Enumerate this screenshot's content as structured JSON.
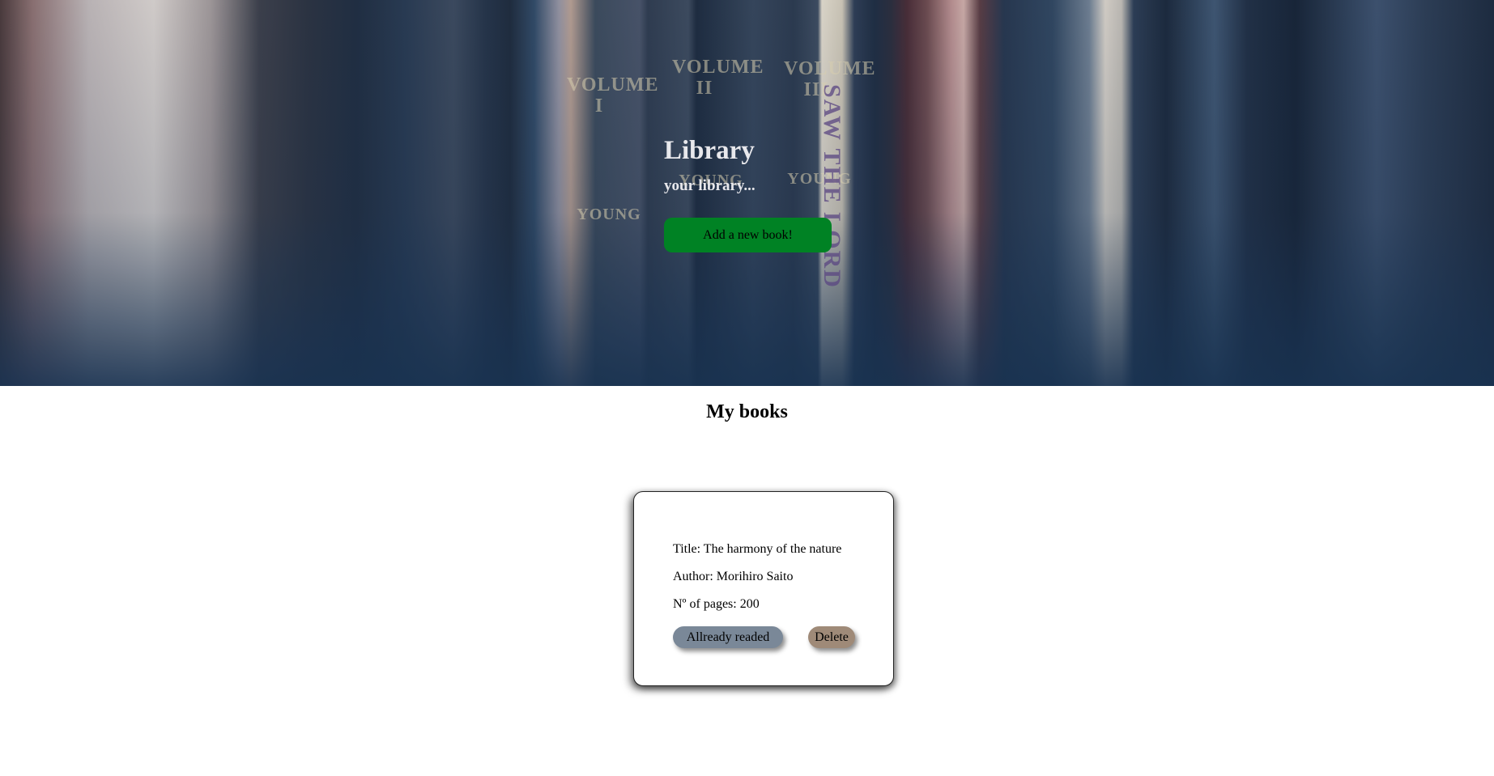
{
  "hero": {
    "title": "Library",
    "subtitle": "your library...",
    "add_button_label": "Add a new book!",
    "add_button_color": "#008224",
    "spines": [
      "VOLUME",
      "II",
      "VOLUME",
      "III",
      "VOLUME",
      "I",
      "YOUNG",
      "YOUNG",
      "YOUNG",
      "SAW THE LORD"
    ]
  },
  "books_section": {
    "title": "My books",
    "books": [
      {
        "title_line": "Title: The harmony of the nature",
        "author_line": "Author: Morihiro Saito",
        "pages_line": "Nº of pages: 200",
        "read_label": "Allready readed",
        "delete_label": "Delete"
      }
    ]
  }
}
